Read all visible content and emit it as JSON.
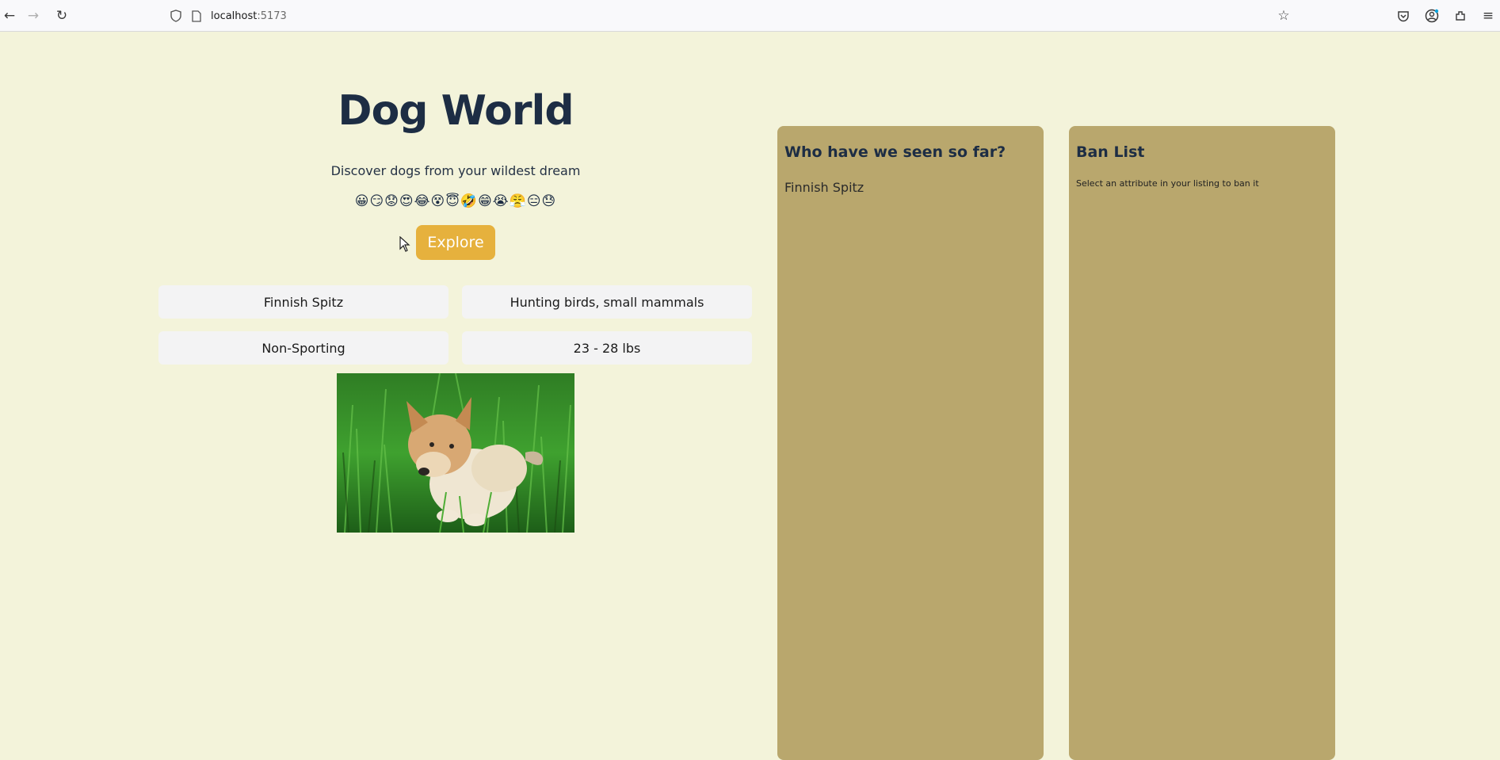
{
  "browser": {
    "url_host": "localhost",
    "url_port": ":5173",
    "icons": [
      "back-icon",
      "forward-icon",
      "reload-icon",
      "shield-icon",
      "page-icon",
      "star-icon",
      "pocket-icon",
      "account-icon",
      "extensions-icon",
      "menu-icon"
    ]
  },
  "hero": {
    "title": "Dog World",
    "subtitle": "Discover dogs from your wildest dream",
    "emojis": "😀😏😟😍😂😵😇🤣😁😭😤😑😓",
    "explore_label": "Explore"
  },
  "attributes": [
    {
      "label": "Finnish Spitz"
    },
    {
      "label": "Hunting birds, small mammals"
    },
    {
      "label": "Non-Sporting"
    },
    {
      "label": "23 - 28 lbs"
    }
  ],
  "seen": {
    "title": "Who have we seen so far?",
    "items": [
      "Finnish Spitz"
    ]
  },
  "ban": {
    "title": "Ban List",
    "hint": "Select an attribute in your listing to ban it"
  },
  "colors": {
    "background": "#f3f3da",
    "accent": "#e6b13d",
    "panel": "#b9a76d",
    "heading": "#1d2d44"
  }
}
